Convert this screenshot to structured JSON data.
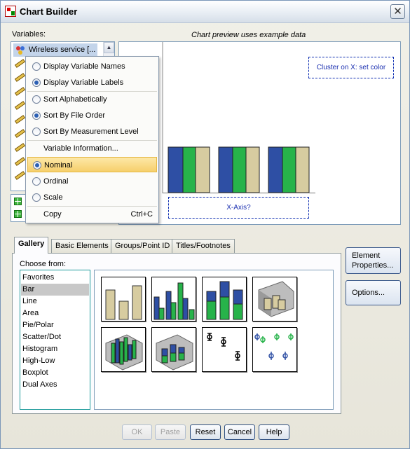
{
  "window": {
    "title": "Chart Builder",
    "close_glyph": "✕"
  },
  "variables": {
    "label": "Variables:",
    "first_item": "Wireless service [...",
    "item_icons": [
      "people-icon",
      "ruler-icon",
      "ruler-icon",
      "ruler-icon",
      "ruler-icon",
      "ruler-icon",
      "ruler-icon",
      "ruler-icon",
      "ruler-icon",
      "ruler-icon"
    ]
  },
  "preview": {
    "note": "Chart preview uses example data",
    "cluster_zone": "Cluster on X: set color",
    "x_axis_zone": "X-Axis?",
    "colors": {
      "blue": "#2e4fa4",
      "green": "#27b34a",
      "tan": "#d7cca0"
    }
  },
  "context_menu": {
    "items": [
      {
        "label": "Display Variable Names",
        "radio": true,
        "checked": false
      },
      {
        "label": "Display Variable Labels",
        "radio": true,
        "checked": true
      },
      {
        "label": "Sort Alphabetically",
        "radio": true,
        "checked": false
      },
      {
        "label": "Sort By File Order",
        "radio": true,
        "checked": true
      },
      {
        "label": "Sort By Measurement Level",
        "radio": true,
        "checked": false
      },
      {
        "label": "Variable Information...",
        "radio": false
      },
      {
        "label": "Nominal",
        "radio": true,
        "checked": true,
        "highlighted": true
      },
      {
        "label": "Ordinal",
        "radio": true,
        "checked": false
      },
      {
        "label": "Scale",
        "radio": true,
        "checked": false
      },
      {
        "label": "Copy",
        "radio": false,
        "shortcut": "Ctrl+C"
      }
    ]
  },
  "tabs": [
    {
      "label": "Gallery",
      "active": true
    },
    {
      "label": "Basic Elements"
    },
    {
      "label": "Groups/Point ID"
    },
    {
      "label": "Titles/Footnotes"
    }
  ],
  "gallery": {
    "choose_label": "Choose from:",
    "types": [
      "Favorites",
      "Bar",
      "Line",
      "Area",
      "Pie/Polar",
      "Scatter/Dot",
      "Histogram",
      "High-Low",
      "Boxplot",
      "Dual Axes"
    ],
    "selected_type": "Bar"
  },
  "side_buttons": {
    "element_properties": "Element Properties...",
    "options": "Options..."
  },
  "buttons": {
    "ok": "OK",
    "paste": "Paste",
    "reset": "Reset",
    "cancel": "Cancel",
    "help": "Help"
  }
}
